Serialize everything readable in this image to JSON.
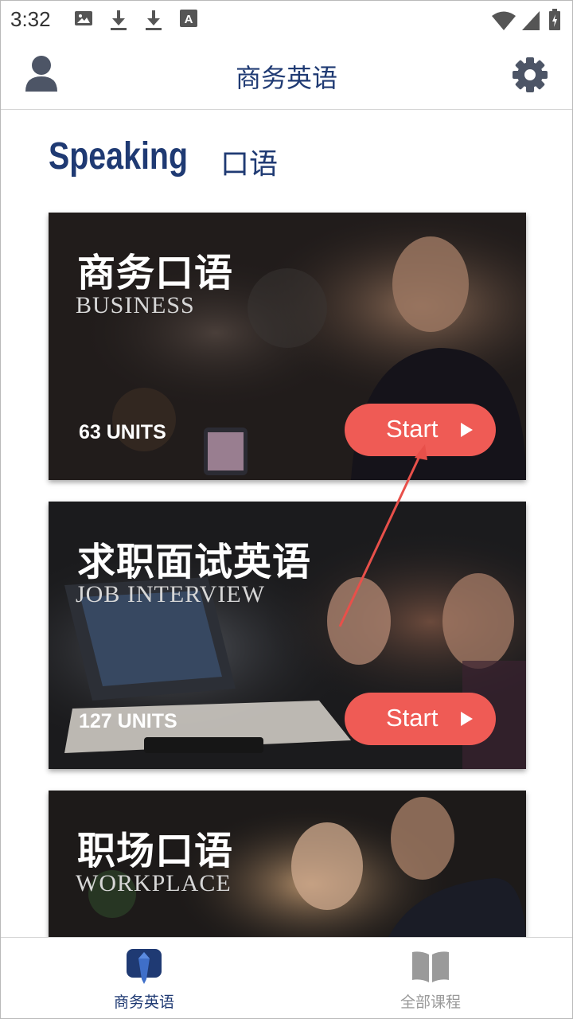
{
  "status_bar": {
    "time": "3:32",
    "icons": [
      "image-icon",
      "download-icon",
      "download-icon",
      "font-icon",
      "wifi-icon",
      "signal-icon",
      "battery-icon"
    ]
  },
  "app_bar": {
    "title": "商务英语",
    "left_icon": "avatar-icon",
    "right_icon": "gear-icon"
  },
  "section": {
    "title_en": "Speaking",
    "title_cn": "口语"
  },
  "cards": [
    {
      "title": "商务口语",
      "subtitle": "BUSINESS",
      "units": "63  UNITS",
      "button": "Start"
    },
    {
      "title": "求职面试英语",
      "subtitle": "JOB INTERVIEW",
      "units": "127  UNITS",
      "button": "Start"
    },
    {
      "title": "职场口语",
      "subtitle": "WORKPLACE"
    }
  ],
  "bottom_nav": {
    "items": [
      {
        "label": "商务英语",
        "icon": "tie-icon",
        "active": true
      },
      {
        "label": "全部课程",
        "icon": "book-icon",
        "active": false
      }
    ]
  },
  "colors": {
    "brand": "#1f3a73",
    "accent": "#ef5b55",
    "inactive": "#9a9a9a",
    "annotation": "#e8504a"
  }
}
